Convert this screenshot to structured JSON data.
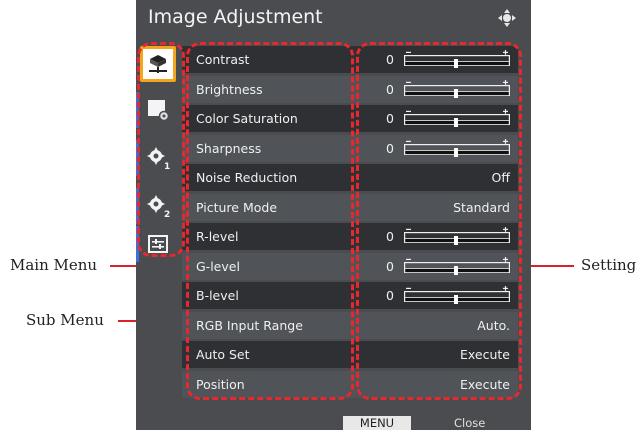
{
  "callouts": {
    "main_menu": "Main Menu",
    "sub_menu": "Sub Menu",
    "setting": "Setting"
  },
  "osd": {
    "title": "Image Adjustment",
    "tabs": [
      {
        "icon": "image-adjustment-icon",
        "active": true
      },
      {
        "icon": "display-settings-icon",
        "active": false
      },
      {
        "icon": "gear-1-icon",
        "active": false
      },
      {
        "icon": "gear-2-icon",
        "active": false
      },
      {
        "icon": "options-icon",
        "active": false
      }
    ],
    "rows": [
      {
        "label": "Contrast",
        "type": "slider",
        "num": "0",
        "level": 0.5
      },
      {
        "label": "Brightness",
        "type": "slider",
        "num": "0",
        "level": 0.5
      },
      {
        "label": "Color Saturation",
        "type": "slider",
        "num": "0",
        "level": 0.5
      },
      {
        "label": "Sharpness",
        "type": "slider",
        "num": "0",
        "level": 0.5
      },
      {
        "label": "Noise Reduction",
        "type": "value",
        "value": "Off"
      },
      {
        "label": "Picture Mode",
        "type": "value",
        "value": "Standard"
      },
      {
        "label": "R-level",
        "type": "slider",
        "num": "0",
        "level": 0.5
      },
      {
        "label": "G-level",
        "type": "slider",
        "num": "0",
        "level": 0.5
      },
      {
        "label": "B-level",
        "type": "slider",
        "num": "0",
        "level": 0.5
      },
      {
        "label": "RGB Input Range",
        "type": "value",
        "value": "Auto."
      },
      {
        "label": "Auto Set",
        "type": "value",
        "value": "Execute"
      },
      {
        "label": "Position",
        "type": "value",
        "value": "Execute"
      }
    ],
    "footer": {
      "menu_key": "MENU",
      "close": "Close"
    },
    "colors": {
      "background": "#4a4c4f",
      "highlight_border": "#f3a51b",
      "annotation": "#e8282f",
      "tab_indicator": "#3e6fd6"
    }
  }
}
